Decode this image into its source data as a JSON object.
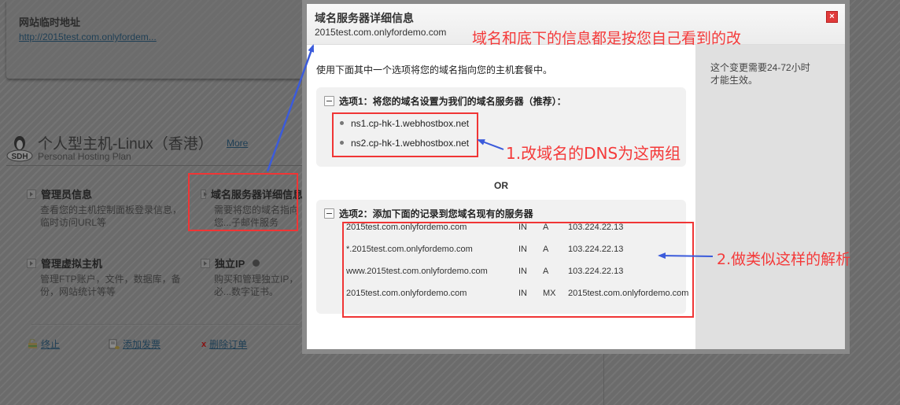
{
  "background": {
    "temp_site": {
      "title": "网站临时地址",
      "url": "http://2015test.com.onlyfordem..."
    },
    "plan": {
      "title": "个人型主机-Linux（香港）",
      "more_label": "More",
      "subtitle": "Personal Hosting Plan",
      "icon": "linux-penguin-icon",
      "icon_badge": "SDH"
    },
    "features": [
      {
        "title": "管理员信息",
        "desc": "查看您的主机控制面板登录信息，临时访问URL等"
      },
      {
        "title": "域名服务器详细信息",
        "desc": "需要将您的域名指向您...子邮件服务"
      },
      {
        "title": "管理虚拟主机",
        "desc": "管理FTP账户，文件，数据库，备份，网站统计等等"
      },
      {
        "title": "独立IP",
        "desc": "购买和管理独立IP，必...数字证书。"
      }
    ],
    "bottom_links": [
      {
        "label": "终止",
        "icon": "lock-icon"
      },
      {
        "label": "添加发票",
        "icon": "invoice-icon"
      },
      {
        "label": "删除订单",
        "icon": "x-icon"
      }
    ]
  },
  "modal": {
    "title": "域名服务器详细信息",
    "domain": "2015test.com.onlyfordemo.com",
    "close_icon": "close-icon",
    "intro": "使用下面其中一个选项将您的域名指向您的主机套餐中。",
    "side_note": "这个变更需要24-72小时才能生效。",
    "option1": {
      "heading": "选项1：将您的域名设置为我们的域名服务器（推荐）：",
      "nameservers": [
        "ns1.cp-hk-1.webhostbox.net",
        "ns2.cp-hk-1.webhostbox.net"
      ]
    },
    "or_label": "OR",
    "option2": {
      "heading": "选项2：添加下面的记录到您域名现有的服务器",
      "records": [
        {
          "name": "2015test.com.onlyfordemo.com",
          "class": "IN",
          "type": "A",
          "value": "103.224.22.13"
        },
        {
          "name": "*.2015test.com.onlyfordemo.com",
          "class": "IN",
          "type": "A",
          "value": "103.224.22.13"
        },
        {
          "name": "www.2015test.com.onlyfordemo.com",
          "class": "IN",
          "type": "A",
          "value": "103.224.22.13"
        },
        {
          "name": "2015test.com.onlyfordemo.com",
          "class": "IN",
          "type": "MX",
          "value": "2015test.com.onlyfordemo.com"
        }
      ]
    }
  },
  "annotations": {
    "top": "域名和底下的信息都是按您自己看到的改",
    "step1": "1.改域名的DNS为这两组",
    "step2": "2.做类似这样的解析",
    "colors": {
      "text": "#f43a3a",
      "box": "#f03535",
      "arrow": "#3b5bdb"
    }
  }
}
